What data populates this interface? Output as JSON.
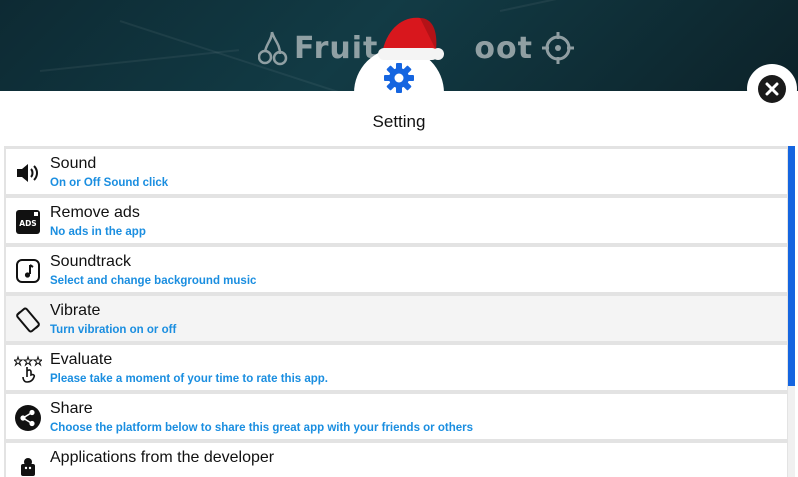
{
  "header": {
    "logo_text_left": "Fruit",
    "logo_text_right": "oot"
  },
  "page": {
    "title": "Setting"
  },
  "colors": {
    "accent": "#1565e0",
    "subtitle": "#1a8ee0",
    "header_bg": "#123b45"
  },
  "settings": {
    "items": [
      {
        "label": "Sound",
        "subtitle": "On or Off Sound click",
        "icon": "speaker-icon"
      },
      {
        "label": "Remove ads",
        "subtitle": "No ads in the app",
        "icon": "ads-icon"
      },
      {
        "label": "Soundtrack",
        "subtitle": "Select and change background music",
        "icon": "music-note-icon"
      },
      {
        "label": "Vibrate",
        "subtitle": "Turn vibration on or off",
        "icon": "vibrate-icon"
      },
      {
        "label": "Evaluate",
        "subtitle": "Please take a moment of your time to rate this app.",
        "icon": "rate-stars-icon"
      },
      {
        "label": "Share",
        "subtitle": "Choose the platform below to share this great app with your friends or others",
        "icon": "share-icon"
      },
      {
        "label": "Applications from the developer",
        "subtitle": "",
        "icon": "developer-apps-icon"
      }
    ]
  }
}
